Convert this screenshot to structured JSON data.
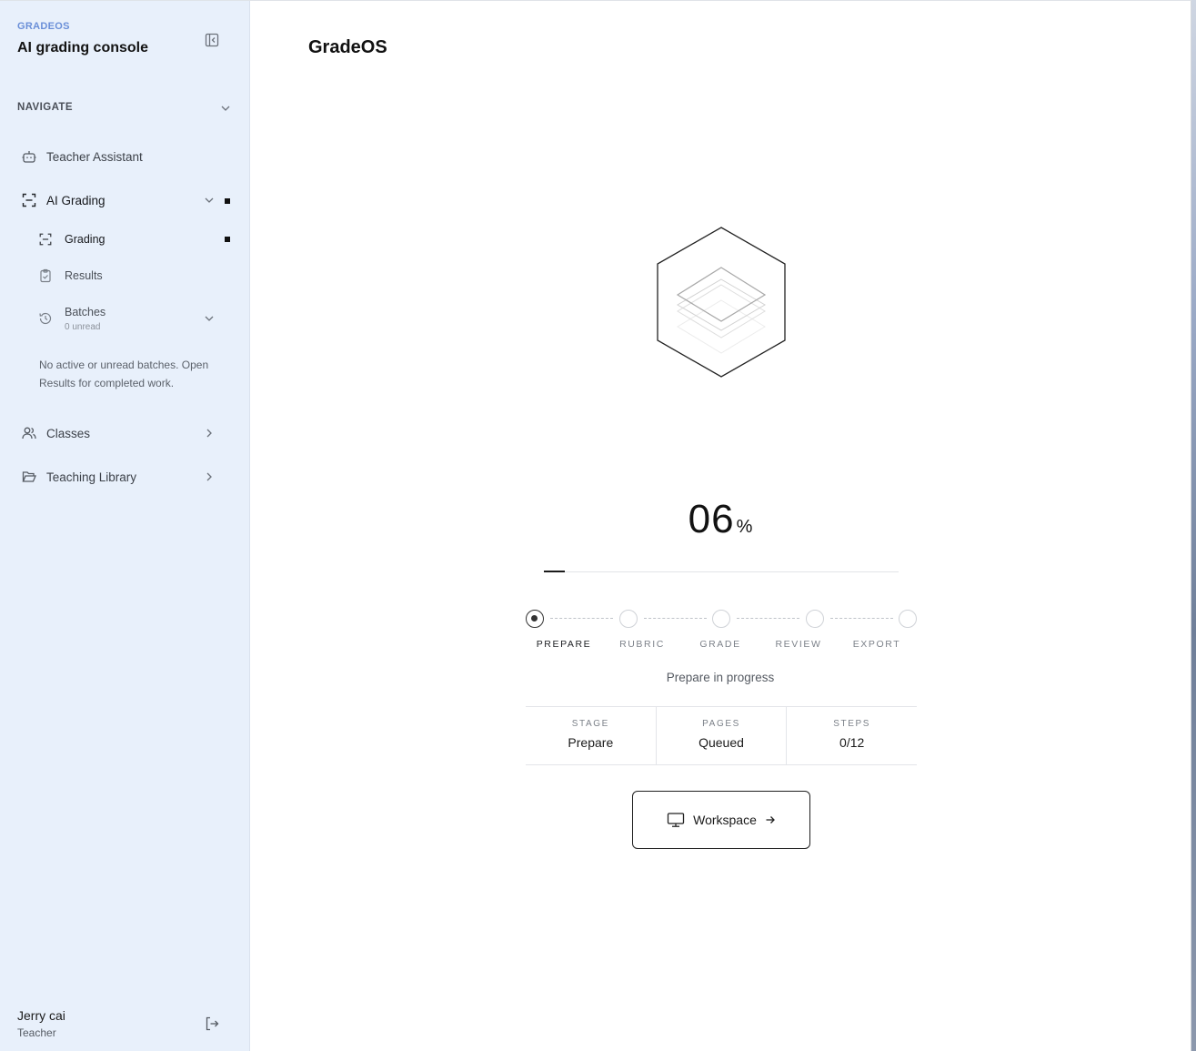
{
  "sidebar": {
    "brand_kicker": "GRADEOS",
    "brand_title": "AI grading console",
    "nav_header": "NAVIGATE",
    "items": {
      "teacher_assistant": "Teacher Assistant",
      "ai_grading": "AI Grading",
      "grading": "Grading",
      "results": "Results",
      "batches": "Batches",
      "batches_sub": "0 unread",
      "classes": "Classes",
      "teaching_library": "Teaching Library"
    },
    "empty_note": "No active or unread batches. Open Results for completed work.",
    "user": {
      "name": "Jerry cai",
      "role": "Teacher"
    }
  },
  "main": {
    "title": "GradeOS",
    "progress": {
      "value": "06",
      "unit": "%",
      "fraction": 0.06
    },
    "steps": [
      {
        "label": "PREPARE",
        "state": "current"
      },
      {
        "label": "RUBRIC",
        "state": "pending"
      },
      {
        "label": "GRADE",
        "state": "pending"
      },
      {
        "label": "REVIEW",
        "state": "pending"
      },
      {
        "label": "EXPORT",
        "state": "pending"
      }
    ],
    "status": "Prepare in progress",
    "stats": [
      {
        "key": "STAGE",
        "value": "Prepare"
      },
      {
        "key": "PAGES",
        "value": "Queued"
      },
      {
        "key": "STEPS",
        "value": "0/12"
      }
    ],
    "workspace_button": "Workspace"
  },
  "colors": {
    "sidebar_bg": "#e8f0fb",
    "brand_accent": "#6a8fd8",
    "ink": "#1a1a1a"
  },
  "icons": [
    "sidebar-collapse-icon",
    "chevron-down-icon",
    "bot-icon",
    "scan-icon",
    "clipboard-check-icon",
    "history-icon",
    "users-icon",
    "folder-open-icon",
    "chevron-right-icon",
    "logout-icon",
    "monitor-icon",
    "arrow-right-icon",
    "hexagon-layers-icon"
  ]
}
